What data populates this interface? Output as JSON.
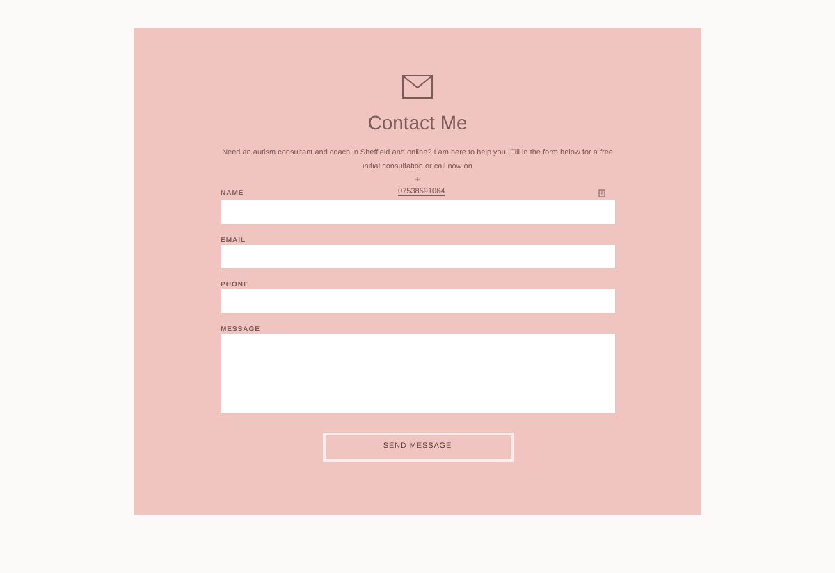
{
  "title": "Contact Me",
  "intro": "Need an autism consultant and coach in Sheffield and online? I am here to help you. Fill in the form below for a free initial consultation or call now on",
  "plus": "+",
  "phone_link": "07538591064",
  "fields": [
    {
      "label": "NAME",
      "kind": "input"
    },
    {
      "label": "EMAIL",
      "kind": "input"
    },
    {
      "label": "PHONE",
      "kind": "input"
    },
    {
      "label": "MESSAGE",
      "kind": "textarea"
    }
  ],
  "submit": "SEND MESSAGE"
}
